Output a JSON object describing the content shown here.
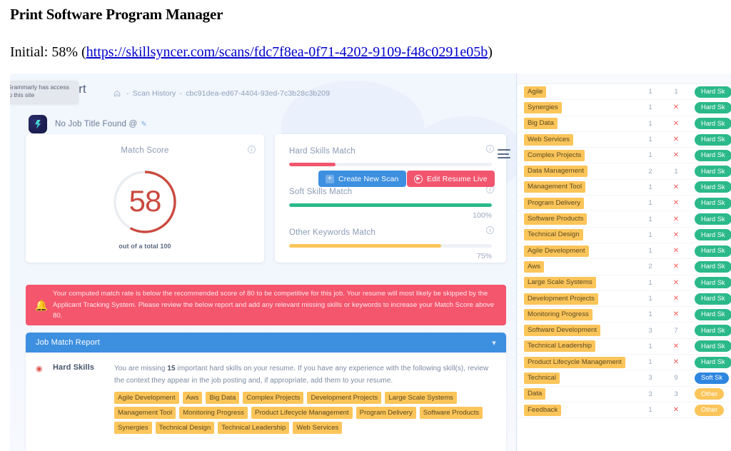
{
  "document": {
    "title": "Print Software Program Manager",
    "initial_prefix": "Initial: 58% (",
    "initial_link": "https://skillsyncer.com/scans/fdc7f8ea-0f71-4202-9109-f48c0291e05b",
    "initial_suffix": ")"
  },
  "grammarly_tooltip": "Grammarly has access to this site",
  "app": {
    "page_title": "Report",
    "breadcrumb": {
      "home_icon": "home-icon",
      "separator": "-",
      "scan_history": "Scan History",
      "scan_id": "cbc91dea-ed67-4404-93ed-7c3b28c3b209"
    },
    "buttons": {
      "create_scan": "Create New Scan",
      "create_scan_icon": "plus-icon",
      "edit_resume": "Edit Resume Live",
      "edit_resume_icon": "play-circle-icon"
    },
    "menu_icon": "hamburger-menu-icon",
    "job": {
      "logo_icon": "skillsyncer-logo-icon",
      "title": "No Job Title Found @",
      "edit_icon": "pencil-icon"
    },
    "score_card": {
      "heading": "Match Score",
      "info_icon": "info-icon",
      "value": "58",
      "subtitle": "out of a total 100",
      "percent": 58,
      "color": "#cb4a3f"
    },
    "bars_card": {
      "info_icon": "info-icon",
      "items": [
        {
          "label": "Hard Skills Match",
          "value": "23%",
          "percent": 23,
          "color": "#f2566e"
        },
        {
          "label": "Soft Skills Match",
          "value": "100%",
          "percent": 100,
          "color": "#2bb98a"
        },
        {
          "label": "Other Keywords Match",
          "value": "75%",
          "percent": 75,
          "color": "#fbc55a"
        }
      ]
    },
    "alert": {
      "icon": "bell-icon",
      "text": "Your computed match rate is below the recommended score of 80 to be competitive for this job. Your resume will most likely be skipped by the Applicant Tracking System. Please review the below report and add any relevant missing skills or keywords to increase your Match Score above 80."
    },
    "report": {
      "heading": "Job Match Report",
      "chevron_icon": "chevron-down-icon",
      "row": {
        "icon": "target-alert-icon",
        "name": "Hard Skills",
        "text_before": "You are missing ",
        "count": "15",
        "text_after": " important hard skills on your resume. If you have any experience with the following skill(s), review the context they appear in the job posting and, if appropriate, add them to your resume.",
        "tags": [
          "Agile Development",
          "Aws",
          "Big Data",
          "Complex Projects",
          "Development Projects",
          "Large Scale Systems",
          "Management Tool",
          "Monitoring Progress",
          "Product Lifecycle Management",
          "Program Delivery",
          "Software Products",
          "Synergies",
          "Technical Design",
          "Technical Leadership",
          "Web Services"
        ]
      }
    },
    "keyword_table": {
      "rows": [
        {
          "keyword": "Agile",
          "count1": "1",
          "count2": "1",
          "badge": "Hard Sk",
          "badge_type": "hard"
        },
        {
          "keyword": "Synergies",
          "count1": "1",
          "count2": "✕",
          "badge": "Hard Sk",
          "badge_type": "hard"
        },
        {
          "keyword": "Big Data",
          "count1": "1",
          "count2": "✕",
          "badge": "Hard Sk",
          "badge_type": "hard"
        },
        {
          "keyword": "Web Services",
          "count1": "1",
          "count2": "✕",
          "badge": "Hard Sk",
          "badge_type": "hard"
        },
        {
          "keyword": "Complex Projects",
          "count1": "1",
          "count2": "✕",
          "badge": "Hard Sk",
          "badge_type": "hard"
        },
        {
          "keyword": "Data Management",
          "count1": "2",
          "count2": "1",
          "badge": "Hard Sk",
          "badge_type": "hard"
        },
        {
          "keyword": "Management Tool",
          "count1": "1",
          "count2": "✕",
          "badge": "Hard Sk",
          "badge_type": "hard"
        },
        {
          "keyword": "Program Delivery",
          "count1": "1",
          "count2": "✕",
          "badge": "Hard Sk",
          "badge_type": "hard"
        },
        {
          "keyword": "Software Products",
          "count1": "1",
          "count2": "✕",
          "badge": "Hard Sk",
          "badge_type": "hard"
        },
        {
          "keyword": "Technical Design",
          "count1": "1",
          "count2": "✕",
          "badge": "Hard Sk",
          "badge_type": "hard"
        },
        {
          "keyword": "Agile Development",
          "count1": "1",
          "count2": "✕",
          "badge": "Hard Sk",
          "badge_type": "hard"
        },
        {
          "keyword": "Aws",
          "count1": "2",
          "count2": "✕",
          "badge": "Hard Sk",
          "badge_type": "hard"
        },
        {
          "keyword": "Large Scale Systems",
          "count1": "1",
          "count2": "✕",
          "badge": "Hard Sk",
          "badge_type": "hard"
        },
        {
          "keyword": "Development Projects",
          "count1": "1",
          "count2": "✕",
          "badge": "Hard Sk",
          "badge_type": "hard"
        },
        {
          "keyword": "Monitoring Progress",
          "count1": "1",
          "count2": "✕",
          "badge": "Hard Sk",
          "badge_type": "hard"
        },
        {
          "keyword": "Software Development",
          "count1": "3",
          "count2": "7",
          "badge": "Hard Sk",
          "badge_type": "hard"
        },
        {
          "keyword": "Technical Leadership",
          "count1": "1",
          "count2": "✕",
          "badge": "Hard Sk",
          "badge_type": "hard"
        },
        {
          "keyword": "Product Lifecycle Management",
          "count1": "1",
          "count2": "✕",
          "badge": "Hard Sk",
          "badge_type": "hard"
        },
        {
          "keyword": "Technical",
          "count1": "3",
          "count2": "9",
          "badge": "Soft Sk",
          "badge_type": "soft"
        },
        {
          "keyword": "Data",
          "count1": "3",
          "count2": "3",
          "badge": "Other",
          "badge_type": "other"
        },
        {
          "keyword": "Feedback",
          "count1": "1",
          "count2": "✕",
          "badge": "Other",
          "badge_type": "other"
        }
      ]
    }
  }
}
